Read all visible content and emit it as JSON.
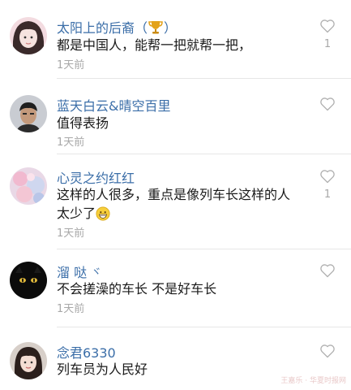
{
  "comments": [
    {
      "username": "太阳上的后裔（",
      "username_tail": "）",
      "username_icon": "trophy-icon",
      "text": "都是中国人，能帮一把就帮一把，",
      "time": "1天前",
      "likes": "1"
    },
    {
      "username": "蓝天白云&晴空百里",
      "text": "值得表扬",
      "time": "1天前",
      "likes": ""
    },
    {
      "username": "心灵之约红红",
      "text": "这样的人很多，重点是像列车长这样的人太少了",
      "text_icon": "grinning-emoji-icon",
      "time": "1天前",
      "likes": "1"
    },
    {
      "username": "溜 哒",
      "username_tail": "ヾ",
      "text": "不会搓澡的车长 不是好车长",
      "time": "1天前",
      "likes": ""
    },
    {
      "username": "念君6330",
      "text": "列车员为人民好",
      "time": "1天前",
      "likes": ""
    }
  ],
  "watermark": "王嘉乐 · 华夏时报网",
  "colors": {
    "username": "#3b6ea8",
    "text": "#1a1a1a",
    "meta": "#a8a8a8",
    "divider": "#e6e6e6"
  }
}
